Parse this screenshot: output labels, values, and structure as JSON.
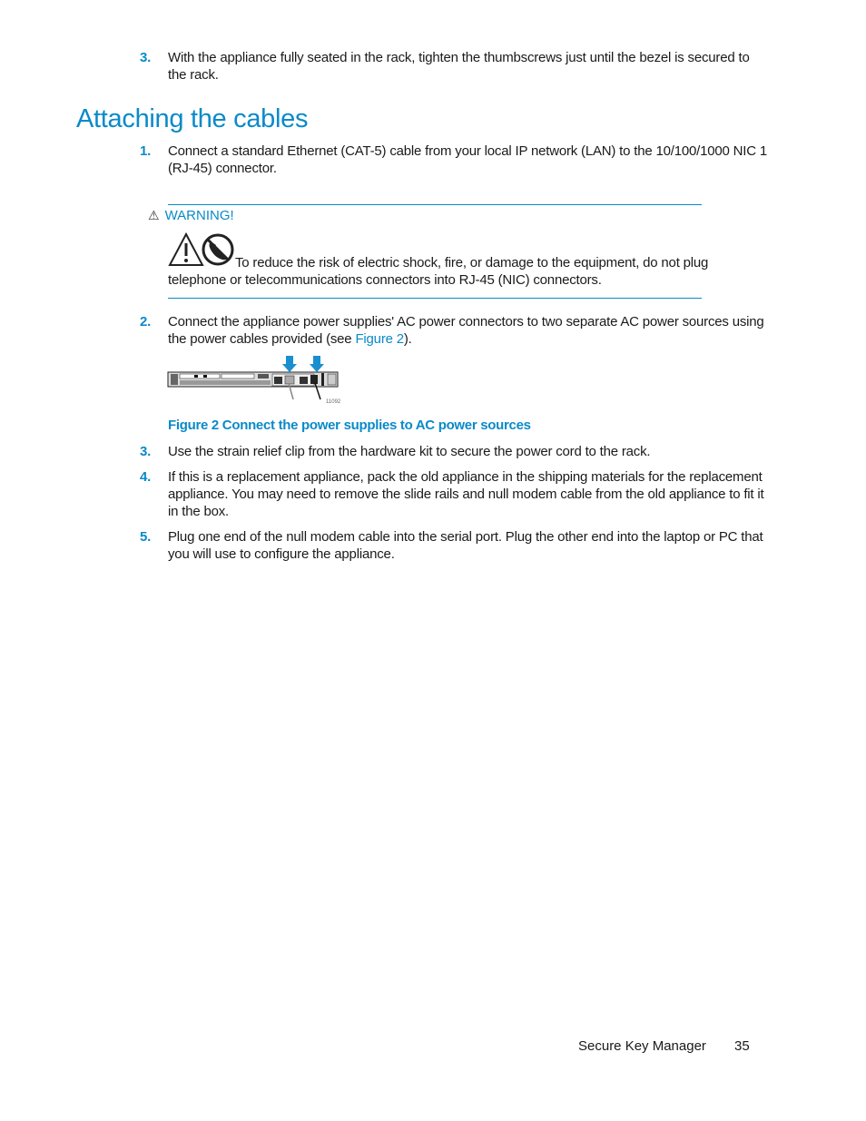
{
  "top_step": {
    "number": "3.",
    "text": "With the appliance fully seated in the rack, tighten the thumbscrews just until the bezel is secured to the rack."
  },
  "section": {
    "title": "Attaching the cables"
  },
  "steps": [
    {
      "number": "1.",
      "text": "Connect a standard Ethernet (CAT-5) cable from your local IP network (LAN) to the 10/100/1000 NIC 1 (RJ-45) connector."
    },
    {
      "number": "2.",
      "text_before": "Connect the appliance power supplies' AC power connectors to two separate AC power sources using the power cables provided (see ",
      "link": "Figure 2",
      "text_after": ")."
    },
    {
      "number": "3.",
      "text": "Use the strain relief clip from the hardware kit to secure the power cord to the rack."
    },
    {
      "number": "4.",
      "text": "If this is a replacement appliance, pack the old appliance in the shipping materials for the replacement appliance. You may need to remove the slide rails and null modem cable from the old appliance to fit it in the box."
    },
    {
      "number": "5.",
      "text": "Plug one end of the null modem cable into the serial port. Plug the other end into the laptop or PC that you will use to configure the appliance."
    }
  ],
  "warning": {
    "title": "WARNING!",
    "icons": [
      "warning-triangle-icon",
      "no-telephone-icon"
    ],
    "text": "To reduce the risk of electric shock, fire, or damage to the equipment, do not plug telephone or telecommunications connectors into RJ-45 (NIC) connectors."
  },
  "figure": {
    "id_label": "11092",
    "caption": "Figure 2 Connect the power supplies to AC power sources"
  },
  "footer": {
    "title": "Secure Key Manager",
    "page": "35"
  },
  "colors": {
    "accent": "#0a8ac9",
    "text": "#1a1a1a"
  }
}
